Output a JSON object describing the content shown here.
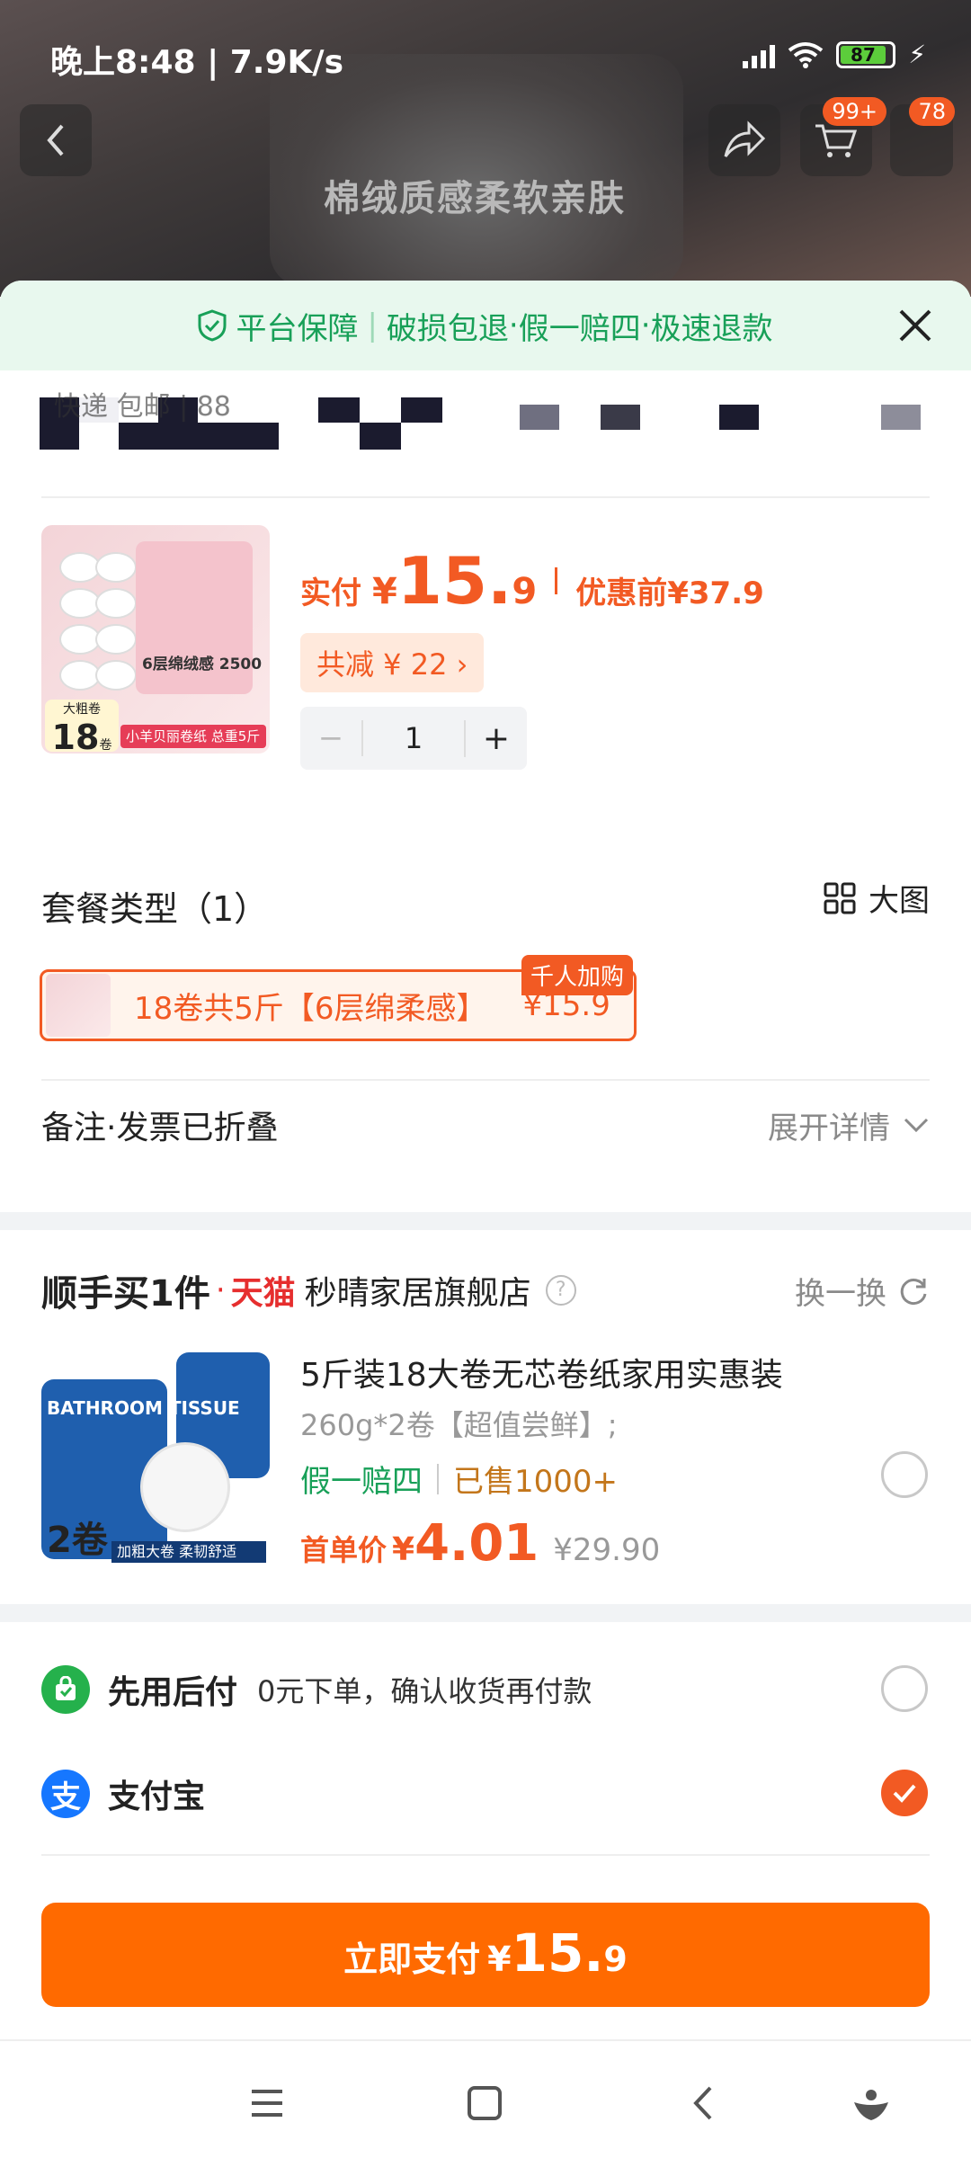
{
  "status_bar": {
    "time": "晚上8:48 | 7.9K/s",
    "battery": "87"
  },
  "header": {
    "badge_cart": "99+",
    "badge_msg": "78",
    "banner_text": "棉绒质感柔软亲肤"
  },
  "guarantee": {
    "title": "平台保障",
    "items": [
      "破损包退",
      "假一赔四",
      "极速退款"
    ]
  },
  "address": {
    "peek": "快递 包邮 | 88"
  },
  "product": {
    "price_label": "实付",
    "currency": "¥",
    "price_int": "15.",
    "price_dec": "9",
    "orig_label": "优惠前",
    "orig_price": "¥37.9",
    "saving": "共减 ¥ 22 ›",
    "quantity": "1",
    "img_tag_top": "大粗卷",
    "img_tag_num": "18",
    "img_tag_unit": "卷",
    "img_strip": "小羊贝丽卷纸 总重5斤",
    "img_pack": "6层绵绒感 2500"
  },
  "package": {
    "heading": "套餐类型（1）",
    "bigview": "大图",
    "option_name": "18卷共5斤【6层绵柔感】",
    "option_price": "¥15.9",
    "badge": "千人加购"
  },
  "note": {
    "label": "备注·发票已折叠",
    "expand": "展开详情"
  },
  "recommend": {
    "title": "顺手买1件",
    "dot": "·",
    "tmall": "天猫",
    "shop": "秒晴家居旗舰店",
    "swap": "换一换",
    "name": "5斤装18大卷无芯卷纸家用实惠装",
    "spec": "260g*2卷【超值尝鲜】;",
    "tag_green": "假一赔四",
    "tag_sold": "已售1000+",
    "price_label": "首单价",
    "currency": "¥",
    "price": "4.01",
    "orig": "¥29.90",
    "img_label": "2卷",
    "img_strip": "加粗大卷 柔韧舒适",
    "img_text": "BATHROOM TISSUE"
  },
  "payment": {
    "option1_name": "先用后付",
    "option1_desc": "0元下单，确认收货再付款",
    "option2_name": "支付宝"
  },
  "pay_button": {
    "label": "立即支付",
    "currency": "¥",
    "int": "15.",
    "dec": "9"
  },
  "colors": {
    "accent": "#f25a23",
    "button": "#ff6a00",
    "green": "#18a058",
    "tmall_red": "#e62e2e"
  }
}
